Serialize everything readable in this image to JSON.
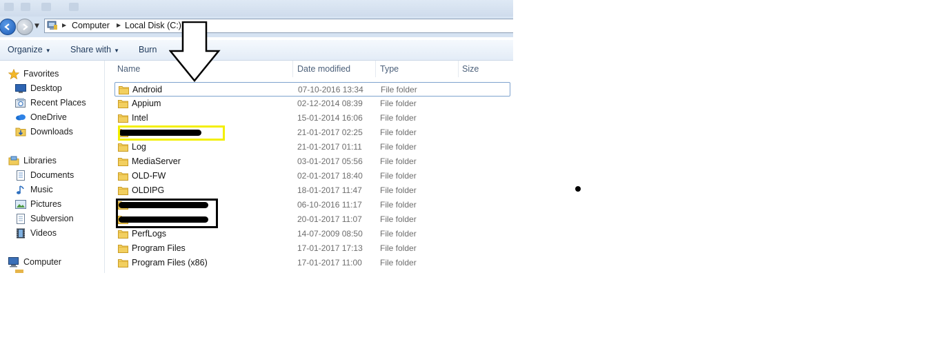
{
  "address_bar": {
    "crumbs": [
      "Computer",
      "Local Disk (C:)"
    ]
  },
  "toolbar": {
    "organize": "Organize",
    "share_with": "Share with",
    "burn": "Burn"
  },
  "nav_pane": {
    "favorites": {
      "label": "Favorites",
      "items": [
        {
          "label": "Desktop",
          "icon": "desktop-icon"
        },
        {
          "label": "Recent Places",
          "icon": "recent-places-icon"
        },
        {
          "label": "OneDrive",
          "icon": "onedrive-icon"
        },
        {
          "label": "Downloads",
          "icon": "downloads-icon"
        }
      ]
    },
    "libraries": {
      "label": "Libraries",
      "items": [
        {
          "label": "Documents",
          "icon": "documents-icon"
        },
        {
          "label": "Music",
          "icon": "music-icon"
        },
        {
          "label": "Pictures",
          "icon": "pictures-icon"
        },
        {
          "label": "Subversion",
          "icon": "subversion-icon"
        },
        {
          "label": "Videos",
          "icon": "videos-icon"
        }
      ]
    },
    "computer": {
      "label": "Computer",
      "icon": "computer-icon"
    }
  },
  "file_list": {
    "columns": [
      "Name",
      "Date modified",
      "Type",
      "Size"
    ],
    "rows": [
      {
        "name": "Android",
        "date": "07-10-2016 13:34",
        "type": "File folder"
      },
      {
        "name": "Appium",
        "date": "02-12-2014 08:39",
        "type": "File folder"
      },
      {
        "name": "Intel",
        "date": "15-01-2014 16:06",
        "type": "File folder"
      },
      {
        "name": "",
        "date": "21-01-2017 02:25",
        "type": "File folder",
        "redacted": true
      },
      {
        "name": "Log",
        "date": "21-01-2017 01:11",
        "type": "File folder"
      },
      {
        "name": "MediaServer",
        "date": "03-01-2017 05:56",
        "type": "File folder"
      },
      {
        "name": "OLD-FW",
        "date": "02-01-2017 18:40",
        "type": "File folder"
      },
      {
        "name": "OLDIPG",
        "date": "18-01-2017 11:47",
        "type": "File folder"
      },
      {
        "name": "",
        "date": "06-10-2016 11:17",
        "type": "File folder",
        "redacted": true
      },
      {
        "name": "",
        "date": "20-01-2017 11:07",
        "type": "File folder",
        "redacted": true
      },
      {
        "name": "PerfLogs",
        "date": "14-07-2009 08:50",
        "type": "File folder"
      },
      {
        "name": "Program Files",
        "date": "17-01-2017 17:13",
        "type": "File folder"
      },
      {
        "name": "Program Files (x86)",
        "date": "17-01-2017 11:00",
        "type": "File folder"
      }
    ]
  },
  "annotations": {
    "arrow": "down-arrow-annotation",
    "highlight_color": "#f3ef00",
    "box_color": "#000000"
  }
}
